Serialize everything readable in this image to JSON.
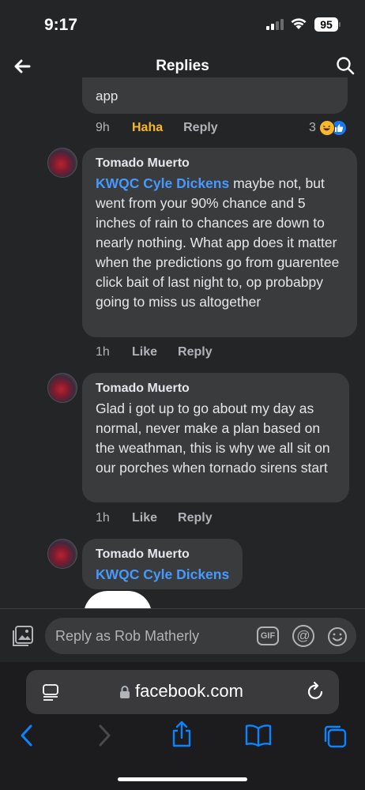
{
  "status": {
    "time": "9:17",
    "battery": "95"
  },
  "header": {
    "title": "Replies"
  },
  "prev_comment": {
    "text_tail": "app",
    "time": "9h",
    "reaction_action": "Haha",
    "reply_label": "Reply",
    "reaction_count": "3"
  },
  "comments": [
    {
      "author": "Tomado Muerto",
      "mention": "KWQC Cyle Dickens",
      "text": " maybe not, but went from your 90% chance and 5 inches of rain to chances are down to nearly nothing.  What app does it matter when the predictions go from guarentee click bait of last night to, op probabpy going to miss us altogether",
      "time": "1h",
      "like_label": "Like",
      "reply_label": "Reply"
    },
    {
      "author": "Tomado Muerto",
      "mention": "",
      "text": "Glad i got up to go about my day as normal, never make a plan based on the weathman, this is why we all sit on our porches when tornado sirens start",
      "time": "1h",
      "like_label": "Like",
      "reply_label": "Reply"
    },
    {
      "author": "Tomado Muerto",
      "mention": "KWQC Cyle Dickens",
      "text": ""
    }
  ],
  "composer": {
    "placeholder": "Reply as Rob Matherly",
    "gif_label": "GIF",
    "at_label": "@"
  },
  "browser": {
    "domain": "facebook.com"
  },
  "colors": {
    "background": "#242526",
    "bubble": "#3a3b3c",
    "mention": "#4599ff",
    "haha": "#f7b928",
    "like_blue": "#1877f2"
  }
}
